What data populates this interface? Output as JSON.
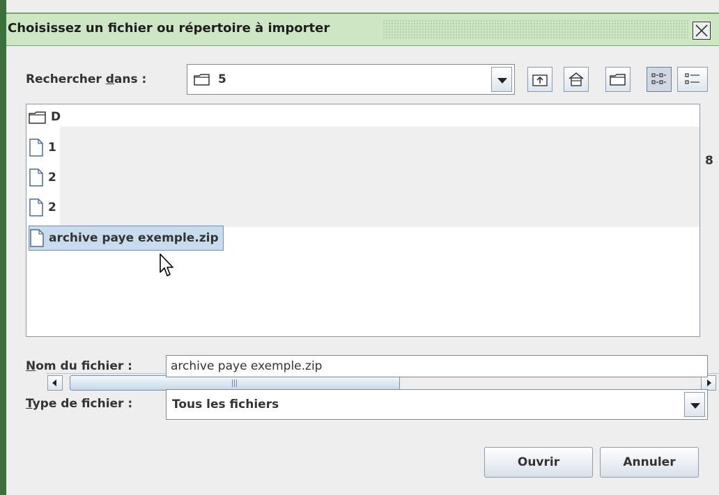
{
  "window": {
    "title": "Choisissez un fichier ou répertoire à importer",
    "close_glyph": "✕"
  },
  "look_in": {
    "label_prefix": "Rechercher ",
    "label_mnemonic": "d",
    "label_suffix": "ans :",
    "value": "5",
    "icon": "folder-icon"
  },
  "toolbar": {
    "buttons": [
      {
        "name": "up-one-level",
        "icon": "folder-up-icon"
      },
      {
        "name": "home",
        "icon": "home-icon"
      },
      {
        "name": "new-folder",
        "icon": "new-folder-icon"
      },
      {
        "name": "list-view",
        "icon": "list-view-icon",
        "pressed": true
      },
      {
        "name": "details-view",
        "icon": "details-view-icon",
        "pressed": false
      }
    ]
  },
  "file_list": {
    "items": [
      {
        "type": "folder",
        "name": "D",
        "partially_hidden": true
      },
      {
        "type": "file",
        "name": "1",
        "partially_hidden": true
      },
      {
        "type": "file",
        "name": "2",
        "partially_hidden": true
      },
      {
        "type": "file",
        "name": "2",
        "partially_hidden": true
      },
      {
        "type": "file",
        "name": "archive paye exemple.zip",
        "selected": true
      }
    ],
    "trailing_visible_char": "8"
  },
  "file_name": {
    "label_mnemonic": "N",
    "label_suffix": "om du fichier :",
    "value": "archive paye exemple.zip"
  },
  "file_type": {
    "label_mnemonic": "T",
    "label_suffix": "ype de fichier :",
    "value": "Tous les fichiers"
  },
  "buttons": {
    "open": "Ouvrir",
    "cancel": "Annuler"
  },
  "colors": {
    "titlebar": "#cfe6c4",
    "selection": "#c9dcee",
    "frame": "#3a6e3a"
  }
}
